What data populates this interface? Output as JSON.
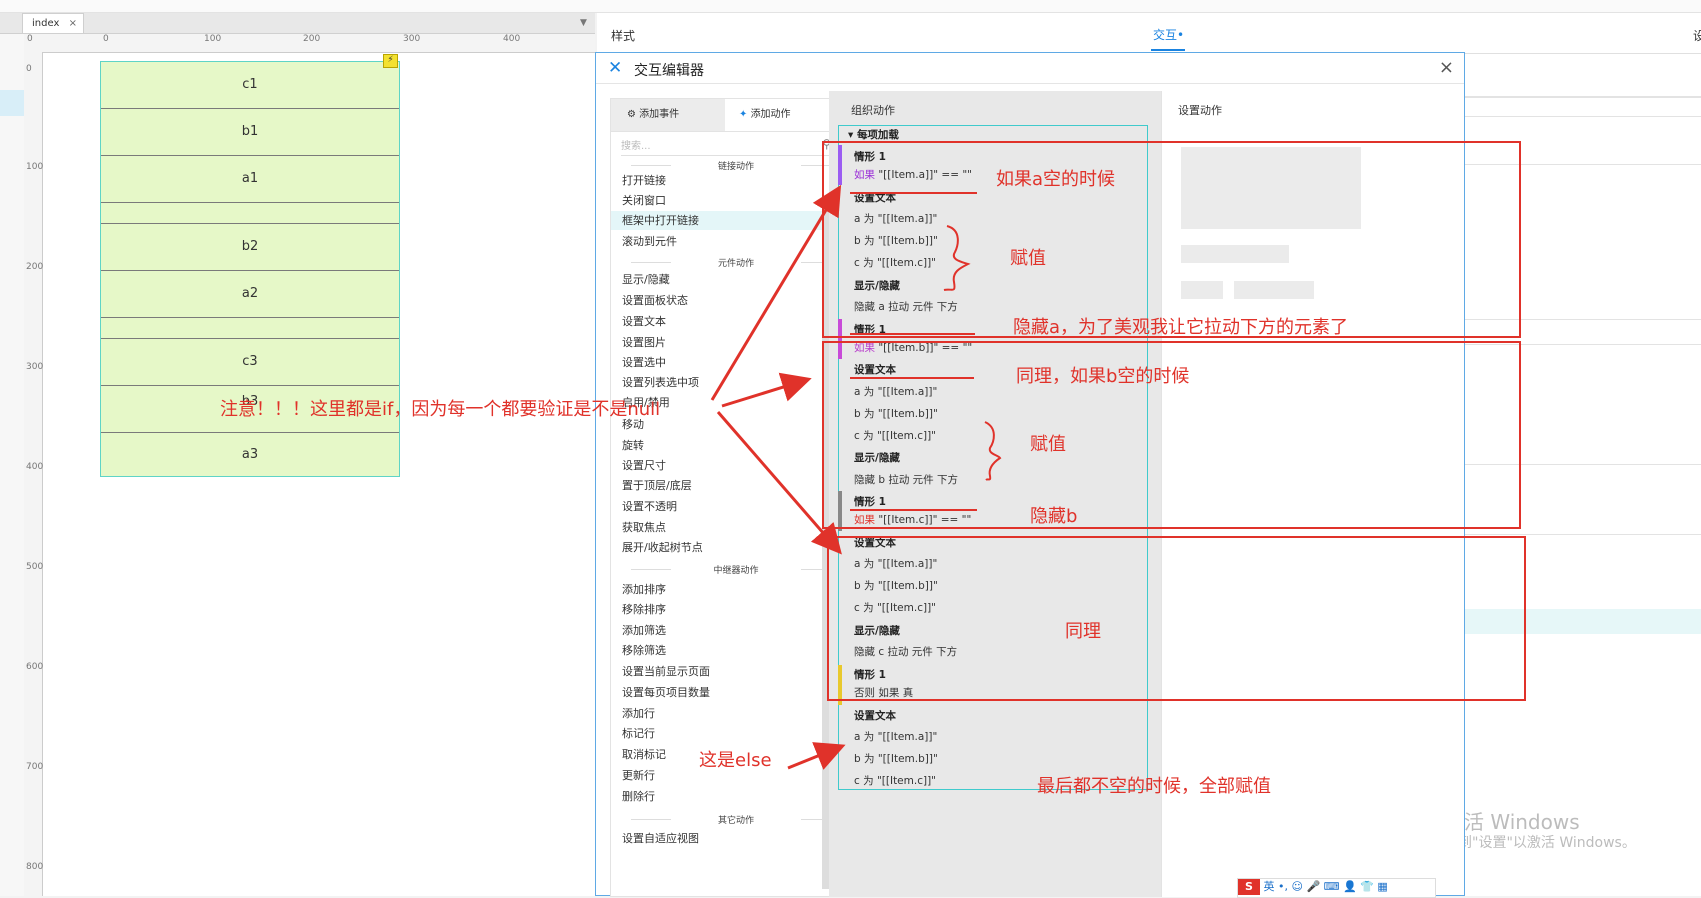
{
  "tabs": {
    "index_label": "index",
    "close_glyph": "×"
  },
  "ruler": {
    "h_ticks": [
      "0",
      "100",
      "200",
      "300",
      "400"
    ],
    "v_ticks": [
      "0",
      "100",
      "200",
      "300",
      "400",
      "500",
      "600",
      "700",
      "800"
    ]
  },
  "repeater": {
    "rows": [
      "c1",
      "b1",
      "a1",
      "",
      "b2",
      "a2",
      "",
      "c3",
      "b3",
      "a3"
    ]
  },
  "right_panel": {
    "style_tab": "样式",
    "interaction_tab": "交互•",
    "cut_label": "设"
  },
  "dialog": {
    "title": "交互编辑器",
    "close_glyph": "×",
    "tab_add_event": "添加事件",
    "tab_add_action": "添加动作",
    "search_placeholder": "搜索...",
    "sections": {
      "link": "链接动作",
      "widget": "元件动作",
      "repeater": "中继器动作",
      "other": "其它动作"
    },
    "link_actions": [
      "打开链接",
      "关闭窗口",
      "框架中打开链接",
      "滚动到元件"
    ],
    "widget_actions": [
      "显示/隐藏",
      "设置面板状态",
      "设置文本",
      "设置图片",
      "设置选中",
      "设置列表选中项",
      "启用/禁用",
      "移动",
      "旋转",
      "设置尺寸",
      "置于顶层/底层",
      "设置不透明",
      "获取焦点",
      "展开/收起树节点"
    ],
    "repeater_actions": [
      "添加排序",
      "移除排序",
      "添加筛选",
      "移除筛选",
      "设置当前显示页面",
      "设置每页项目数量",
      "添加行",
      "标记行",
      "取消标记",
      "更新行",
      "删除行"
    ],
    "other_actions": [
      "设置自适应视图"
    ],
    "organize_header": "组织动作",
    "settings_header": "设置动作",
    "event_name": "每项加载",
    "cases": [
      {
        "name": "情形 1",
        "cond_kw": "如果",
        "cond": "\"[[Item.a]]\" == \"\"",
        "set_text": "设置文本",
        "a": "a 为 \"[[Item.a]]\"",
        "b": "b 为 \"[[Item.b]]\"",
        "c": "c 为 \"[[Item.c]]\"",
        "show_hide": "显示/隐藏",
        "hide": "隐藏 a  拉动 元件 下方"
      },
      {
        "name": "情形 1",
        "cond_kw": "如果",
        "cond": "\"[[Item.b]]\" == \"\"",
        "set_text": "设置文本",
        "a": "a 为 \"[[Item.a]]\"",
        "b": "b 为 \"[[Item.b]]\"",
        "c": "c 为 \"[[Item.c]]\"",
        "show_hide": "显示/隐藏",
        "hide": "隐藏 b  拉动 元件 下方"
      },
      {
        "name": "情形 1",
        "cond_kw": "如果",
        "cond": "\"[[Item.c]]\" == \"\"",
        "set_text": "设置文本",
        "a": "a 为 \"[[Item.a]]\"",
        "b": "b 为 \"[[Item.b]]\"",
        "c": "c 为 \"[[Item.c]]\"",
        "show_hide": "显示/隐藏",
        "hide": "隐藏 c  拉动 元件 下方"
      },
      {
        "name": "情形 1",
        "cond_kw": "否则 如果",
        "cond": "真",
        "set_text": "设置文本",
        "a": "a 为 \"[[Item.a]]\"",
        "b": "b 为 \"[[Item.b]]\"",
        "c": "c 为 \"[[Item.c]]\""
      }
    ]
  },
  "annotations": {
    "note_if": "注意！！！这里都是if，因为每一个都要验证是不是null",
    "a_empty": "如果a空的时候",
    "assign1": "赋值",
    "hide_a": "隐藏a，为了美观我让它拉动下方的元素了",
    "b_empty": "同理，如果b空的时候",
    "assign2": "赋值",
    "hide_b": "隐藏b",
    "same": "同理",
    "else": "这是else",
    "final": "最后都不空的时候，全部赋值"
  },
  "watermark": {
    "line1": "激活 Windows",
    "line2": "转到\"设置\"以激活 Windows。"
  },
  "ime": {
    "label": "英"
  },
  "colors": {
    "accent": "#1a83e0",
    "annotation": "#e0322a",
    "cyan": "#3fcacc"
  }
}
